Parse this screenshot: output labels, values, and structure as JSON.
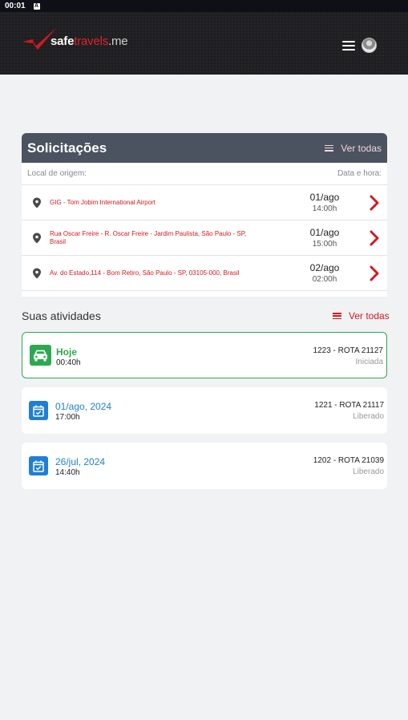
{
  "status_bar": {
    "time": "00:01",
    "badge": "A"
  },
  "header": {
    "logo": {
      "part1": "safe",
      "part2": "travels",
      "part3": ".me"
    }
  },
  "solicitacoes": {
    "title": "Solicitações",
    "ver_todas": "Ver todas",
    "col_origin": "Local de origem:",
    "col_datetime": "Data e hora:",
    "items": [
      {
        "address": "GIG - Tom Jobim International Airport",
        "date": "01/ago",
        "time": "14:00h"
      },
      {
        "address": "Rua Oscar Freire - R. Oscar Freire - Jardim Paulista, São Paulo - SP, Brasil",
        "date": "01/ago",
        "time": "15:00h"
      },
      {
        "address": "Av. do Estado,114 - Bom Retiro, São Paulo - SP, 03105-000, Brasil",
        "date": "02/ago",
        "time": "02:00h"
      }
    ]
  },
  "atividades": {
    "title": "Suas atividades",
    "ver_todas": "Ver todas",
    "items": [
      {
        "label": "Hoje",
        "time": "00:40h",
        "route": "1223 - ROTA 21127",
        "status": "Iniciada",
        "icon": "car-icon",
        "color": "#2ea84f"
      },
      {
        "label": "01/ago, 2024",
        "time": "17:00h",
        "route": "1221 - ROTA 21117",
        "status": "Liberado",
        "icon": "calendar-check-icon",
        "color": "#1e7fd4"
      },
      {
        "label": "26/jul, 2024",
        "time": "14:40h",
        "route": "1202 - ROTA 21039",
        "status": "Liberado",
        "icon": "calendar-check-icon",
        "color": "#1e7fd4"
      }
    ]
  },
  "colors": {
    "brand_red": "#d2191f",
    "header_bg": "#1f1f22",
    "card_header_bg": "#4b5260",
    "active_green": "#2ea84f",
    "date_blue": "#1e7fd4"
  }
}
